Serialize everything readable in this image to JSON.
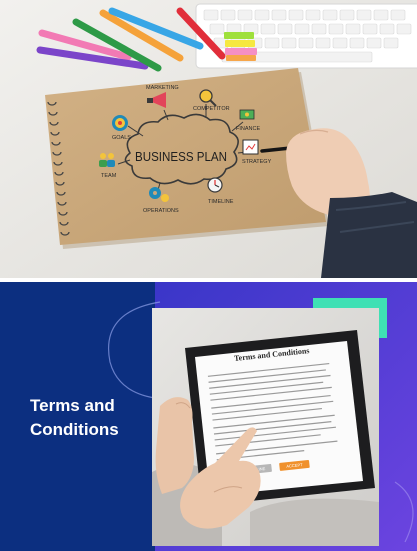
{
  "top_image": {
    "center_text": "BUSINESS PLAN",
    "labels": [
      {
        "key": "goals",
        "text": "GOALS"
      },
      {
        "key": "marketing",
        "text": "MARKETING"
      },
      {
        "key": "competitor",
        "text": "COMPETITOR"
      },
      {
        "key": "finance",
        "text": "FINANCE"
      },
      {
        "key": "strategy",
        "text": "STRATEGY"
      },
      {
        "key": "timeline",
        "text": "TIMELINE"
      },
      {
        "key": "operations",
        "text": "OPERATIONS"
      },
      {
        "key": "team",
        "text": "TEAM"
      }
    ]
  },
  "bottom_banner": {
    "title_line1": "Terms and",
    "title_line2": "Conditions",
    "tablet_heading": "Terms and Conditions",
    "decline_label": "DECLINE",
    "accept_label": "ACCEPT"
  },
  "colors": {
    "banner_navy": "#0c2f80",
    "banner_purple": "#5b3ed9",
    "accent_teal": "#3fe0b4",
    "accept_orange": "#f0912c",
    "decline_gray": "#b7b7b7",
    "notebook_kraft": "#c9a77b"
  }
}
